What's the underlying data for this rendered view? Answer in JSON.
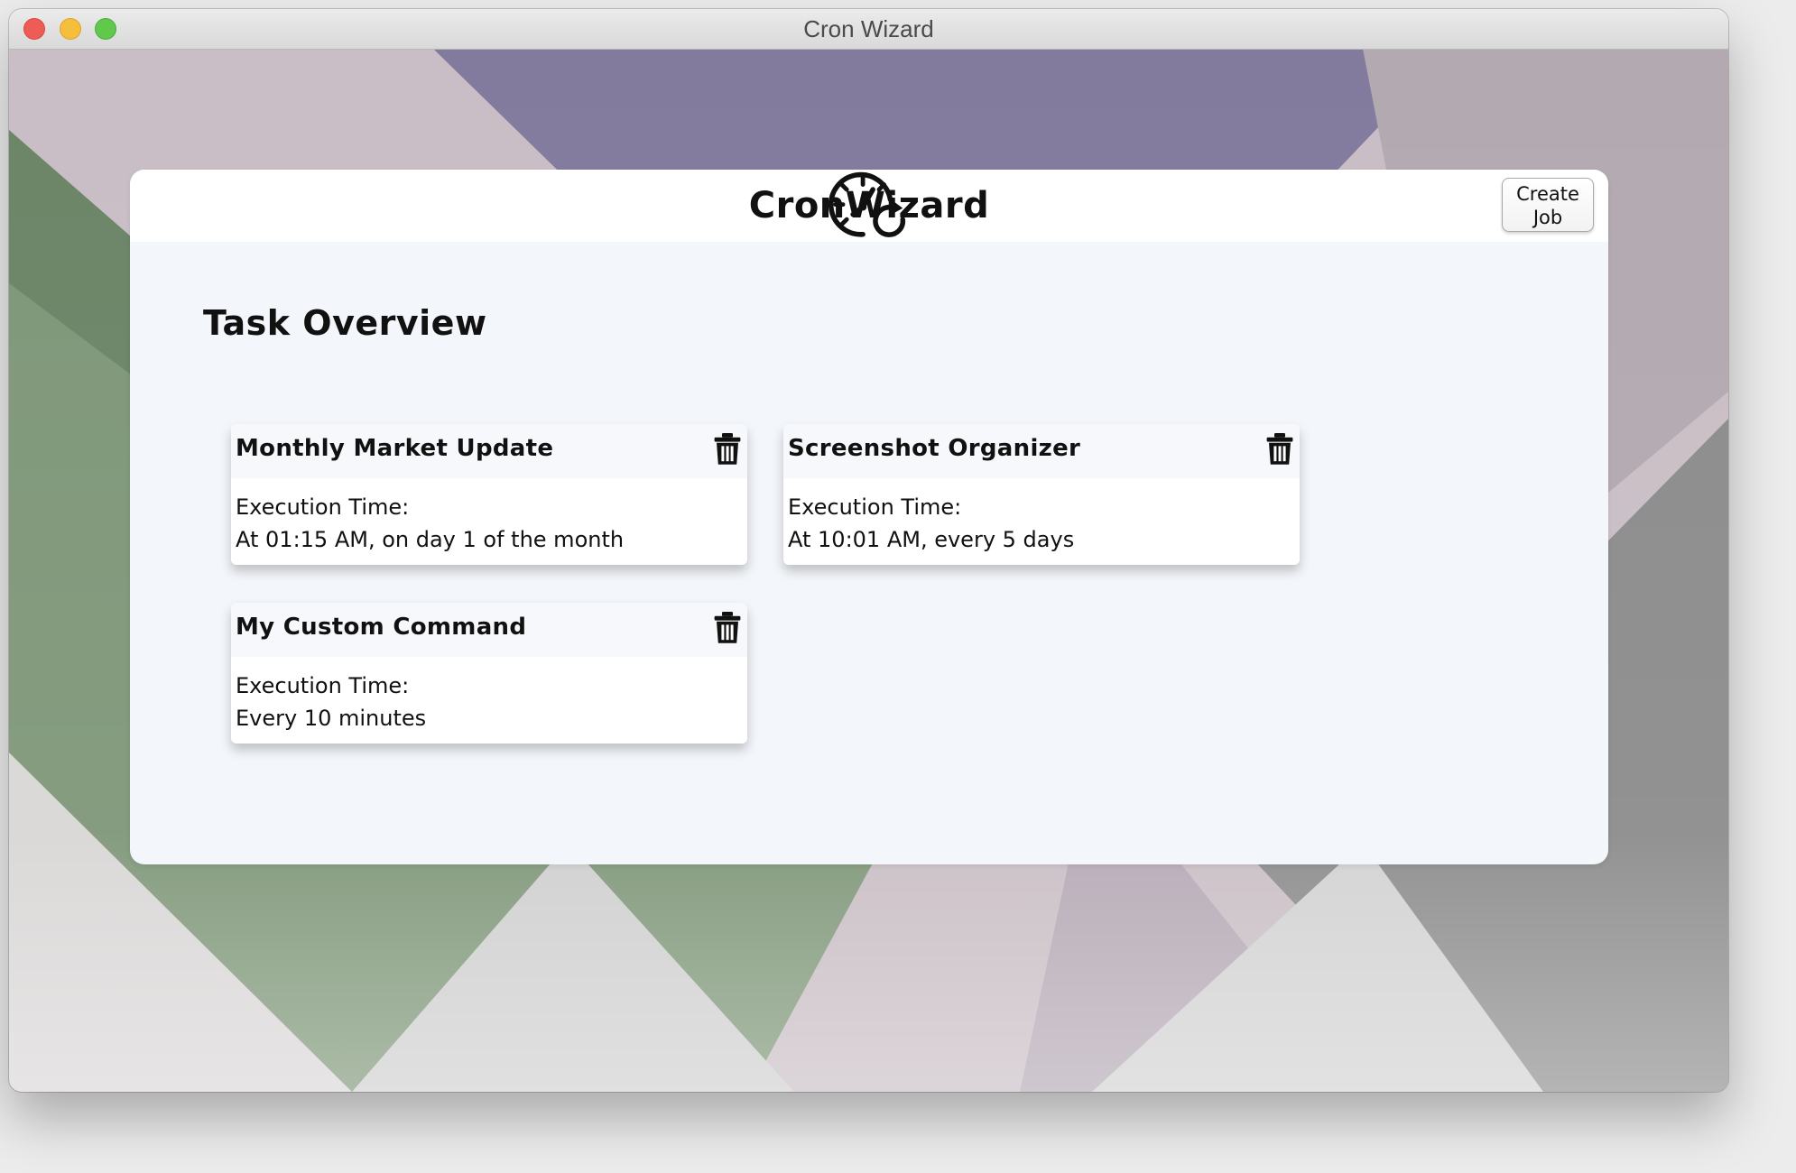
{
  "window": {
    "title": "Cron Wizard",
    "controls": [
      "close",
      "minimize",
      "zoom"
    ]
  },
  "app": {
    "logo_icon": "clock-refresh-icon",
    "title": "CronWizard",
    "create_button": {
      "line1": "Create",
      "line2": "Job"
    }
  },
  "overview": {
    "heading": "Task Overview",
    "execution_label": "Execution Time:",
    "tasks": [
      {
        "name": "Monthly Market Update",
        "execution_time": "At 01:15 AM, on day 1 of the month",
        "delete_icon": "trash-icon"
      },
      {
        "name": "Screenshot Organizer",
        "execution_time": "At 10:01 AM, every 5 days",
        "delete_icon": "trash-icon"
      },
      {
        "name": "My Custom Command",
        "execution_time": "Every 10 minutes",
        "delete_icon": "trash-icon"
      }
    ]
  },
  "colors": {
    "panel_background": "#f3f6fa",
    "card_background": "#ffffff",
    "close": "#ee5d55",
    "minimize": "#f5be3d",
    "zoom": "#5fc84d"
  }
}
